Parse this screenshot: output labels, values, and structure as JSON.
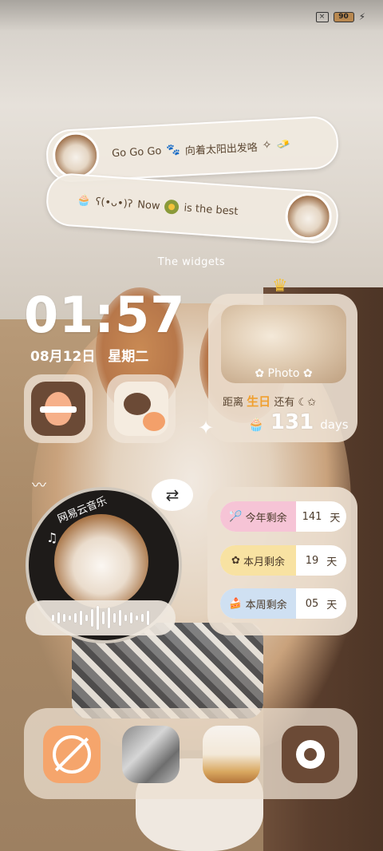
{
  "status_bar": {
    "battery": "90"
  },
  "pill_top": {
    "text_main": "Go Go Go",
    "text_sub": "向着太阳出发咯"
  },
  "pill_bottom": {
    "kaomoji": "ʕ(•ᴗ•)ʔ",
    "now": "Now",
    "rest": "is the best"
  },
  "widgets_caption": "The widgets",
  "clock": {
    "time": "01:57",
    "date": "08月12日",
    "weekday": "星期二"
  },
  "birthday": {
    "photo_label": "Photo",
    "prefix": "距离",
    "highlight": "生日",
    "suffix": "还有",
    "days": "131",
    "unit": "days"
  },
  "music": {
    "app_title": "网易云音乐"
  },
  "remain": [
    {
      "label": "今年剩余",
      "value": "141",
      "unit": "天"
    },
    {
      "label": "本月剩余",
      "value": "19",
      "unit": "天"
    },
    {
      "label": "本周剩余",
      "value": "05",
      "unit": "天"
    }
  ],
  "icons": {
    "qq": "qq-icon",
    "wechat": "wechat-icon",
    "browser": "compass-icon",
    "gallery": "gallery-icon",
    "cake_app": "cake-icon",
    "settings": "settings-icon"
  }
}
